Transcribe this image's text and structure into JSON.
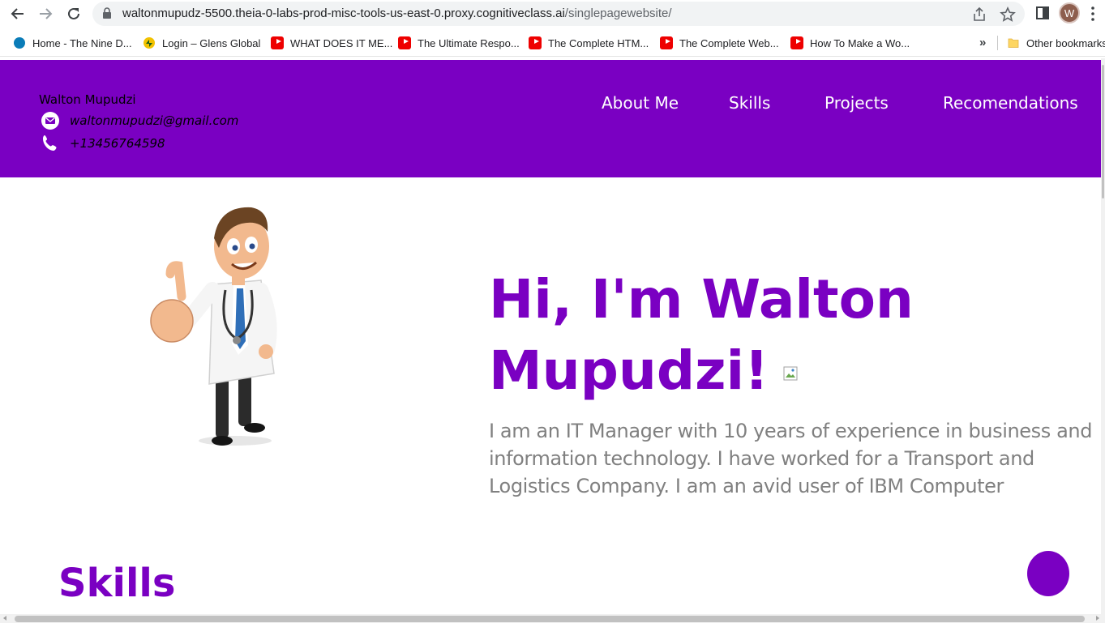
{
  "browser": {
    "url_host": "waltonmupudz-5500.theia-0-labs-prod-misc-tools-us-east-0.proxy.cognitiveclass.ai",
    "url_path": "/singlepagewebsite/",
    "profile_initial": "W",
    "icons": [
      "back-arrow-icon",
      "forward-arrow-icon",
      "reload-icon",
      "lock-icon",
      "share-icon",
      "star-icon",
      "side-panel-icon",
      "menu-kebab-icon"
    ]
  },
  "bookmarks": {
    "items": [
      {
        "label": "Home - The Nine D...",
        "icon": "globe-icon"
      },
      {
        "label": "Login – Glens Global",
        "icon": "glens-logo-icon"
      },
      {
        "label": "WHAT DOES IT ME...",
        "icon": "youtube-icon"
      },
      {
        "label": "The Ultimate Respo...",
        "icon": "youtube-icon"
      },
      {
        "label": "The Complete HTM...",
        "icon": "youtube-icon"
      },
      {
        "label": "The Complete Web...",
        "icon": "youtube-icon"
      },
      {
        "label": "How To Make a Wo...",
        "icon": "youtube-icon"
      }
    ],
    "overflow": "»",
    "other": "Other bookmarks"
  },
  "header": {
    "name": "Walton Mupudzi",
    "email": "waltonmupudzi@gmail.com",
    "phone": "+13456764598",
    "nav": [
      "About Me",
      "Skills",
      "Projects",
      "Recomendations"
    ]
  },
  "hero": {
    "title_line1": "Hi, I'm Walton",
    "title_line2": "Mupudzi!",
    "description": "I am an IT Manager with 10 years of experience in business and information technology. I have worked for a Transport and Logistics Company. I am an avid user of IBM Computer"
  },
  "skills": {
    "heading": "Skills"
  },
  "colors": {
    "brand": "#7a00c2",
    "description_text": "#808080",
    "nav_text": "#ffffff"
  }
}
